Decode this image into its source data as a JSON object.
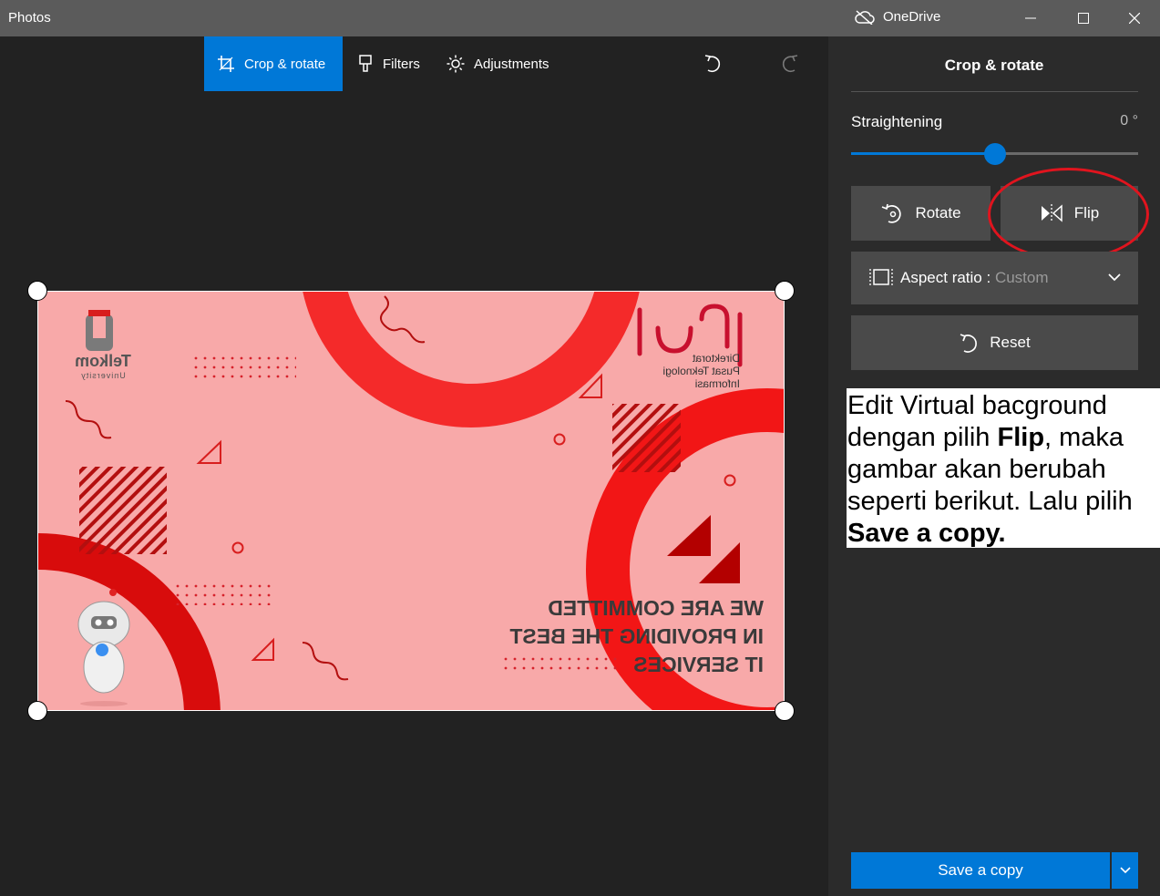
{
  "window": {
    "app_title": "Photos",
    "cloud_service": "OneDrive",
    "icons": [
      "cloud-off-icon",
      "minimize-icon",
      "maximize-icon",
      "close-icon"
    ]
  },
  "toolbar": {
    "tabs": [
      {
        "label": "Crop & rotate",
        "icon": "crop-icon",
        "active": true
      },
      {
        "label": "Filters",
        "icon": "brush-icon",
        "active": false
      },
      {
        "label": "Adjustments",
        "icon": "sun-icon",
        "active": false
      }
    ],
    "undo_icon": "undo-icon",
    "redo_icon": "redo-icon"
  },
  "photo": {
    "logo_left": "Telkom",
    "logo_left_sub": "University",
    "logo_right_sub": [
      "Direktorat",
      "Pusat Teknologi",
      "Informasi"
    ],
    "slogan": [
      "WE ARE COMMITTED",
      "IN PROVIDING THE BEST",
      "IT SERVICES"
    ]
  },
  "panel": {
    "title": "Crop & rotate",
    "straightening_label": "Straightening",
    "straightening_value": "0 °",
    "straightening_position": 0.5,
    "rotate_label": "Rotate",
    "flip_label": "Flip",
    "aspect_label": "Aspect ratio : ",
    "aspect_value": "Custom",
    "reset_label": "Reset",
    "save_label": "Save a copy",
    "accent_color": "#0078d7",
    "highlight_color": "#e0141e"
  },
  "note": {
    "part1": "Edit Virtual bacground dengan pilih ",
    "bold1": "Flip",
    "part2": ", maka gambar akan berubah seperti berikut. Lalu pilih ",
    "bold2": "Save a copy."
  }
}
